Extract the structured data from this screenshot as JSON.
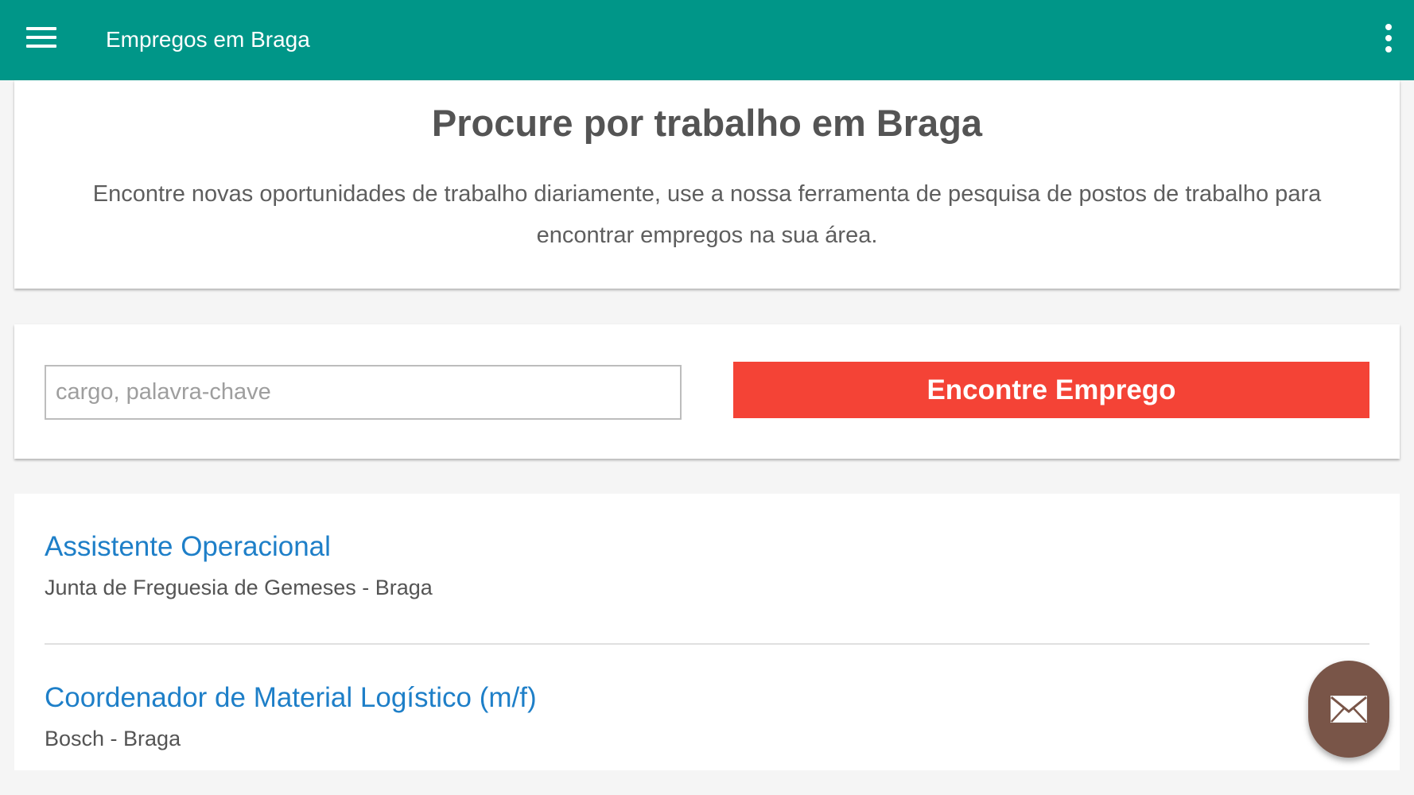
{
  "appbar": {
    "title": "Empregos em Braga",
    "color": "#009688"
  },
  "hero": {
    "title": "Procure por trabalho em Braga",
    "description": "Encontre novas oportunidades de trabalho diariamente, use a nossa ferramenta de pesquisa de postos de trabalho para encontrar empregos na sua área."
  },
  "search": {
    "placeholder": "cargo, palavra-chave",
    "value": "",
    "button_label": "Encontre Emprego",
    "button_color": "#f44336"
  },
  "jobs": [
    {
      "title": "Assistente Operacional",
      "meta": "Junta de Freguesia de Gemeses - Braga"
    },
    {
      "title": "Coordenador de Material Logístico (m/f)",
      "meta": "Bosch - Braga"
    }
  ],
  "fab": {
    "icon": "mail-icon",
    "color": "#795548"
  }
}
